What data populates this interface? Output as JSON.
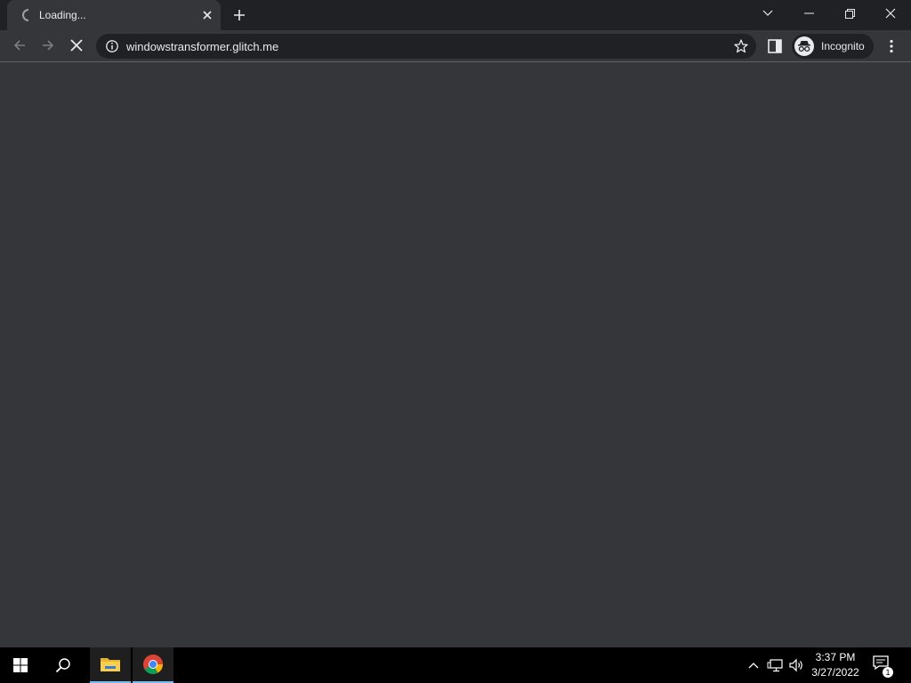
{
  "tab": {
    "title": "Loading..."
  },
  "omnibox": {
    "url": "windowstransformer.glitch.me"
  },
  "profile": {
    "label": "Incognito"
  },
  "clock": {
    "time": "3:37 PM",
    "date": "3/27/2022"
  },
  "notifications": {
    "count": "1"
  },
  "colors": {
    "titlebar": "#202124",
    "toolbar": "#35363a",
    "accent": "#8ab4f8",
    "taskbar": "#000000"
  },
  "icons": {
    "tab": [
      "loading-spinner-icon",
      "close-icon",
      "plus-icon"
    ],
    "window": [
      "chevron-down-icon",
      "minimize-icon",
      "restore-icon",
      "close-icon"
    ],
    "toolbar": [
      "back-arrow-icon",
      "forward-arrow-icon",
      "stop-icon",
      "info-icon",
      "star-icon",
      "side-panel-icon",
      "incognito-icon",
      "kebab-menu-icon"
    ],
    "taskbar": [
      "windows-start-icon",
      "search-icon",
      "file-explorer-icon",
      "chrome-icon",
      "chevron-up-icon",
      "network-icon",
      "volume-icon",
      "notification-icon"
    ]
  }
}
